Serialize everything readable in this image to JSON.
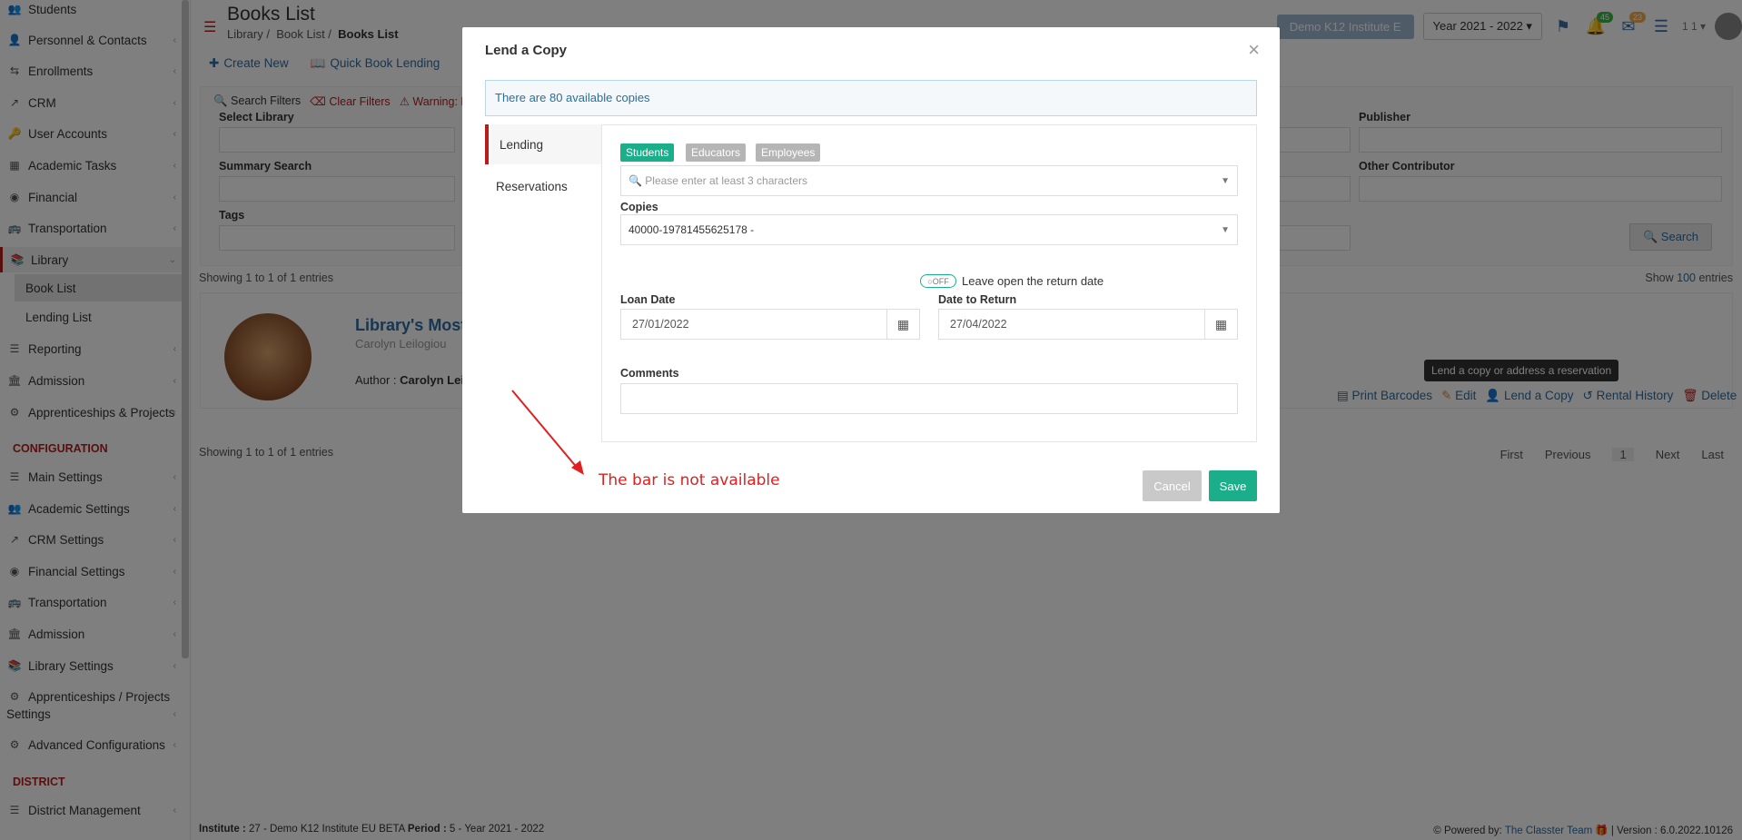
{
  "sidebar": {
    "items": [
      {
        "label": "Students",
        "icon": "users-icon"
      },
      {
        "label": "Personnel & Contacts",
        "icon": "contacts-icon"
      },
      {
        "label": "Enrollments",
        "icon": "swap-icon"
      },
      {
        "label": "CRM",
        "icon": "crm-icon"
      },
      {
        "label": "User Accounts",
        "icon": "key-icon"
      },
      {
        "label": "Academic Tasks",
        "icon": "grid-icon"
      },
      {
        "label": "Financial",
        "icon": "coins-icon"
      },
      {
        "label": "Transportation",
        "icon": "bus-icon"
      },
      {
        "label": "Library",
        "icon": "books-icon"
      },
      {
        "label": "Reporting",
        "icon": "db-icon"
      },
      {
        "label": "Admission",
        "icon": "bank-icon"
      },
      {
        "label": "Apprenticeships & Projects",
        "icon": "cog-icon"
      }
    ],
    "sub_items": [
      {
        "label": "Book List"
      },
      {
        "label": "Lending List"
      }
    ],
    "config_title": "CONFIGURATION",
    "config_items": [
      {
        "label": "Main Settings"
      },
      {
        "label": "Academic Settings"
      },
      {
        "label": "CRM Settings"
      },
      {
        "label": "Financial Settings"
      },
      {
        "label": "Transportation"
      },
      {
        "label": "Admission"
      },
      {
        "label": "Library Settings"
      },
      {
        "label": "Apprenticeships / Projects"
      },
      {
        "label": "Settings"
      },
      {
        "label": "Advanced Configurations"
      }
    ],
    "district_title": "DISTRICT",
    "district_items": [
      {
        "label": "District Management"
      }
    ]
  },
  "header": {
    "title": "Books List",
    "breadcrumb": [
      "Library",
      "Book List",
      "Books List"
    ],
    "institute": "Demo K12 Institute E",
    "year": "Year 2021 - 2022",
    "notif_count": "45",
    "msg_count": "23",
    "user_short": "1 1"
  },
  "actions": {
    "create": "Create New",
    "quick": "Quick Book Lending"
  },
  "filters": {
    "search_filters": "Search Filters",
    "clear": "Clear Filters",
    "warning": "Warning: Filte",
    "select_library": "Select Library",
    "summary": "Summary Search",
    "tags": "Tags",
    "publisher": "Publisher",
    "other": "Other Contributor",
    "search_btn": "Search"
  },
  "list": {
    "showing": "Showing 1 to 1 of 1 entries",
    "show": "Show",
    "show_count": "100",
    "entries": "entries",
    "book_title": "Library's Most W",
    "book_author": "Carolyn Leilogiou",
    "author_label": "Author :",
    "author_name": "Carolyn Leilo",
    "tooltip": "Lend a copy or address a reservation",
    "act_print": "Print Barcodes",
    "act_edit": "Edit",
    "act_lend": "Lend a Copy",
    "act_history": "Rental History",
    "act_delete": "Delete",
    "pager": {
      "first": "First",
      "prev": "Previous",
      "page": "1",
      "next": "Next",
      "last": "Last"
    }
  },
  "footer": {
    "institute_label": "Institute :",
    "institute": "27 - Demo K12 Institute EU BETA",
    "period_label": "Period :",
    "period": "5 - Year 2021 - 2022",
    "powered": "Powered by:",
    "team": "The Classter Team",
    "version": "| Version : 6.0.2022.10126"
  },
  "modal": {
    "title": "Lend a Copy",
    "alert": "There are 80 available copies",
    "tabs": [
      "Lending",
      "Reservations"
    ],
    "pills": [
      "Students",
      "Educators",
      "Employees"
    ],
    "search_placeholder": "Please enter at least 3 characters",
    "copies_label": "Copies",
    "copies_value": "40000-19781455625178 -",
    "toggle_state": "OFF",
    "toggle_label": "Leave open the return date",
    "loan_label": "Loan Date",
    "loan_value": "27/01/2022",
    "return_label": "Date to Return",
    "return_value": "27/04/2022",
    "comments_label": "Comments",
    "cancel": "Cancel",
    "save": "Save"
  },
  "annotation": {
    "text": "The bar is not available",
    "color": "#e02020"
  },
  "colors": {
    "accent": "#b71c1c",
    "primary": "#1aae8a",
    "link": "#2d6ca2"
  }
}
